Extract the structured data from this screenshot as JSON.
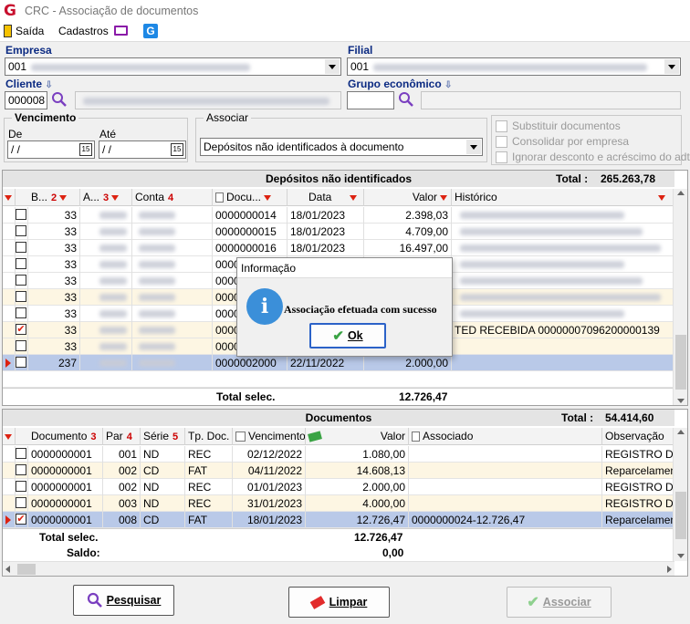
{
  "window": {
    "title": "CRC - Associação de documentos"
  },
  "toolbar": {
    "exit_label": "Saída",
    "register_label": "Cadastros"
  },
  "filters": {
    "empresa_label": "Empresa",
    "empresa_code": "001",
    "filial_label": "Filial",
    "filial_code": "001",
    "cliente_label": "Cliente",
    "cliente_code": "000008",
    "grupo_label": "Grupo econômico",
    "vencimento_label": "Vencimento",
    "de_label": "De",
    "ate_label": "Até",
    "date_placeholder": " / /",
    "associar_label": "Associar",
    "associar_value": "Depósitos não identificados à documento",
    "opt_substituir": "Substituir documentos",
    "opt_consolidar": "Consolidar por empresa",
    "opt_ignorar": "Ignorar desconto e acréscimo do adto"
  },
  "depositos": {
    "title": "Depósitos não identificados",
    "total_label": "Total :",
    "total_value": "265.263,78",
    "columns": [
      "B...",
      "2",
      "A...",
      "3",
      "Conta",
      "4",
      "Docu...",
      "Data",
      "Valor",
      "Histórico"
    ],
    "rows": [
      {
        "b": "33",
        "doc": "0000000014",
        "data": "18/01/2023",
        "valor": "2.398,03",
        "hist": "",
        "checked": false
      },
      {
        "b": "33",
        "doc": "0000000015",
        "data": "18/01/2023",
        "valor": "4.709,00",
        "hist": "",
        "checked": false
      },
      {
        "b": "33",
        "doc": "0000000016",
        "data": "18/01/2023",
        "valor": "16.497,00",
        "hist": "",
        "checked": false
      },
      {
        "b": "33",
        "doc": "0000",
        "data": "",
        "valor": "",
        "hist": "",
        "checked": false
      },
      {
        "b": "33",
        "doc": "0000",
        "data": "",
        "valor": "",
        "hist": "",
        "checked": false
      },
      {
        "b": "33",
        "doc": "0000",
        "data": "",
        "valor": "",
        "hist": "",
        "checked": false
      },
      {
        "b": "33",
        "doc": "0000",
        "data": "",
        "valor": "",
        "hist": "",
        "checked": false
      },
      {
        "b": "33",
        "doc": "0000",
        "data": "",
        "valor": "",
        "hist": "TED RECEBIDA  00000007096200000139",
        "checked": true
      },
      {
        "b": "33",
        "doc": "0000",
        "data": "",
        "valor": "",
        "hist": "",
        "checked": false
      },
      {
        "b": "237",
        "doc": "0000002000",
        "data": "22/11/2022",
        "valor": "2.000,00",
        "hist": "",
        "checked": false
      }
    ],
    "total_selec_label": "Total selec.",
    "total_selec_value": "12.726,47"
  },
  "documentos": {
    "title": "Documentos",
    "total_label": "Total :",
    "total_value": "54.414,60",
    "columns": [
      "Documento",
      "3",
      "Par",
      "4",
      "Série",
      "5",
      "Tp. Doc.",
      "Vencimento",
      "Valor",
      "Associado",
      "Observação"
    ],
    "rows": [
      {
        "doc": "0000000001",
        "par": "001",
        "serie": "ND",
        "tp": "REC",
        "venc": "02/12/2022",
        "valor": "1.080,00",
        "assoc": "",
        "obs": "REGISTRO DE",
        "checked": false
      },
      {
        "doc": "0000000001",
        "par": "002",
        "serie": "CD",
        "tp": "FAT",
        "venc": "04/11/2022",
        "valor": "14.608,13",
        "assoc": "",
        "obs": "Reparcelament",
        "checked": false
      },
      {
        "doc": "0000000001",
        "par": "002",
        "serie": "ND",
        "tp": "REC",
        "venc": "01/01/2023",
        "valor": "2.000,00",
        "assoc": "",
        "obs": "REGISTRO DE",
        "checked": false
      },
      {
        "doc": "0000000001",
        "par": "003",
        "serie": "ND",
        "tp": "REC",
        "venc": "31/01/2023",
        "valor": "4.000,00",
        "assoc": "",
        "obs": "REGISTRO DE",
        "checked": false
      },
      {
        "doc": "0000000001",
        "par": "008",
        "serie": "CD",
        "tp": "FAT",
        "venc": "18/01/2023",
        "valor": "12.726,47",
        "assoc": "0000000024-12.726,47",
        "obs": "Reparcelament",
        "checked": true
      }
    ],
    "total_selec_label": "Total selec.",
    "total_selec_value": "12.726,47",
    "saldo_label": "Saldo:",
    "saldo_value": "0,00"
  },
  "buttons": {
    "pesquisar": "Pesquisar",
    "limpar": "Limpar",
    "associar": "Associar"
  },
  "dialog": {
    "title": "Informação",
    "message": "Associação efetuada com sucesso",
    "ok": "Ok"
  },
  "icons": {
    "exit": "door-exit-icon",
    "monitor": "monitor-icon",
    "app": "g-logo-icon",
    "search": "magnifier-icon",
    "calendar": "calendar-icon",
    "money": "money-icon",
    "check": "check-icon",
    "eraser": "eraser-icon",
    "info": "info-icon"
  },
  "colors": {
    "accent_blue": "#0b2a82",
    "selection": "#b9c9e8",
    "filter_red": "#dd2211",
    "row_highlight": "#fdf6e3"
  }
}
